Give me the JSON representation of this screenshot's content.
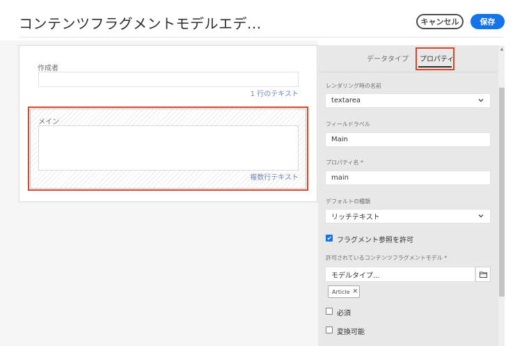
{
  "header": {
    "title": "コンテンツフラグメントモデルエデ...",
    "cancel_label": "キャンセル",
    "save_label": "保存"
  },
  "canvas": {
    "author": {
      "label": "作成者",
      "type_label": "1 行のテキスト"
    },
    "main": {
      "label": "メイン",
      "type_label": "複数行テキスト"
    }
  },
  "panel": {
    "tabs": [
      {
        "label": "データタイプ",
        "selected": false
      },
      {
        "label": "プロパティ",
        "selected": true
      }
    ],
    "render_as": {
      "label": "レンダリング時の名前",
      "value": "textarea"
    },
    "field_label": {
      "label": "フィールドラベル",
      "value": "Main"
    },
    "property_name": {
      "label": "プロパティ名 *",
      "value": "main"
    },
    "default_type": {
      "label": "デフォルトの種類",
      "value": "リッチテキスト"
    },
    "allow_fragment_ref": {
      "label": "フラグメント参照を許可",
      "checked": true
    },
    "allowed_models": {
      "label": "許可されているコンテンツフラグメントモデル *",
      "placeholder": "モデルタイプ...",
      "browse_icon": "folder-icon",
      "tags": [
        {
          "label": "Article"
        }
      ]
    },
    "required": {
      "label": "必須",
      "checked": false
    },
    "translatable": {
      "label": "変換可能",
      "checked": false
    }
  },
  "colors": {
    "accent": "#1473e6",
    "highlight": "#d9472b",
    "panel_bg": "#e8e8e8"
  }
}
